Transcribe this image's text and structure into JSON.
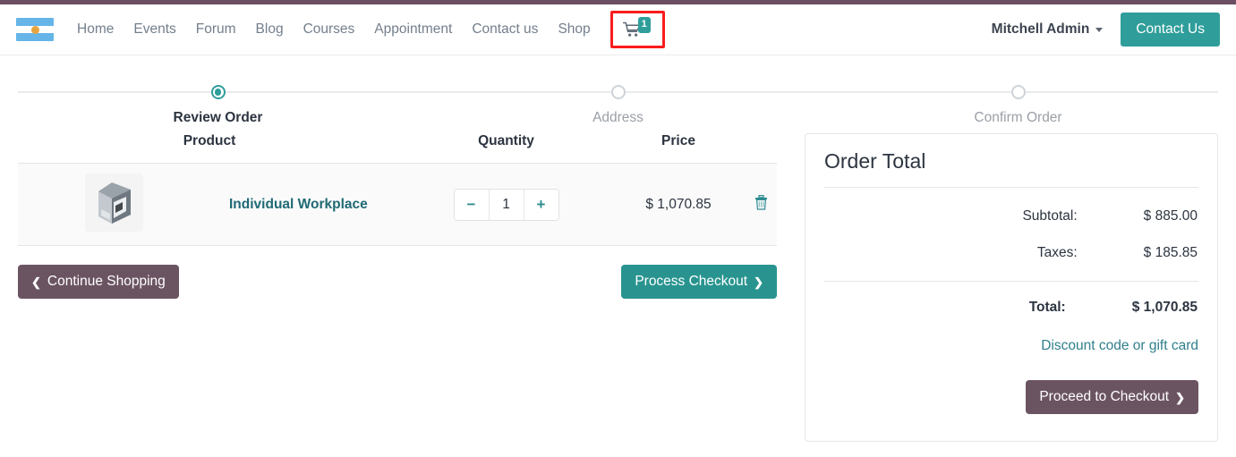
{
  "brand": {
    "logo_icon": "argentina-flag-logo",
    "accent_teal": "#2f9e9a",
    "accent_mauve": "#6b5462",
    "highlight_red": "#f91c1c"
  },
  "header": {
    "nav_items": [
      {
        "label": "Home"
      },
      {
        "label": "Events"
      },
      {
        "label": "Forum"
      },
      {
        "label": "Blog"
      },
      {
        "label": "Courses"
      },
      {
        "label": "Appointment"
      },
      {
        "label": "Contact us"
      },
      {
        "label": "Shop"
      }
    ],
    "cart": {
      "icon": "shopping-cart-icon",
      "badge_count": "1",
      "highlighted": true
    },
    "user_name": "Mitchell Admin",
    "contact_button": "Contact Us"
  },
  "stepper": {
    "steps": [
      {
        "label": "Review Order",
        "state": "active"
      },
      {
        "label": "Address",
        "state": "upcoming"
      },
      {
        "label": "Confirm Order",
        "state": "upcoming"
      }
    ]
  },
  "cart": {
    "columns": {
      "product": "Product",
      "quantity": "Quantity",
      "price": "Price"
    },
    "lines": [
      {
        "thumbnail_icon": "workplace-product-image",
        "name": "Individual Workplace",
        "quantity": "1",
        "decrease_label": "−",
        "increase_label": "+",
        "price": "$ 1,070.85",
        "delete_icon": "trash-icon"
      }
    ],
    "continue_shopping": "Continue Shopping",
    "process_checkout": "Process Checkout"
  },
  "order_total": {
    "title": "Order Total",
    "rows": [
      {
        "label": "Subtotal:",
        "value": "$ 885.00"
      },
      {
        "label": "Taxes:",
        "value": "$ 185.85"
      }
    ],
    "grand": {
      "label": "Total:",
      "value": "$ 1,070.85"
    },
    "discount_link": "Discount code or gift card",
    "proceed_button": "Proceed to Checkout"
  }
}
